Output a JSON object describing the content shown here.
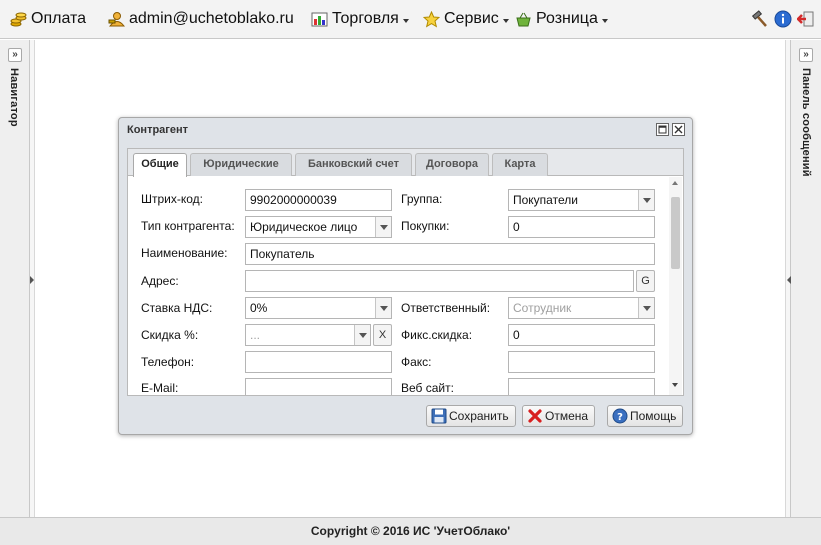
{
  "topbar": {
    "items": [
      {
        "label": "Оплата"
      },
      {
        "label": "admin@uchetoblako.ru"
      },
      {
        "label": "Торговля"
      },
      {
        "label": "Сервис"
      },
      {
        "label": "Розница"
      }
    ]
  },
  "left_panel": {
    "label": "Навигатор",
    "collapse_glyph": "»"
  },
  "right_panel": {
    "label": "Панель сообщений",
    "collapse_glyph": "»"
  },
  "footer": {
    "copyright": "Copyright © 2016 ИС 'УчетОблако'"
  },
  "dialog": {
    "title": "Контрагент",
    "tabs": [
      {
        "label": "Общие"
      },
      {
        "label": "Юридические"
      },
      {
        "label": "Банковский счет"
      },
      {
        "label": "Договора"
      },
      {
        "label": "Карта"
      }
    ],
    "active_tab": "Общие",
    "fields": {
      "barcode": {
        "label": "Штрих-код:",
        "value": "9902000000039"
      },
      "group": {
        "label": "Группа:",
        "value": "Покупатели"
      },
      "contractor_type": {
        "label": "Тип контрагента:",
        "value": "Юридическое лицо"
      },
      "purchases": {
        "label": "Покупки:",
        "value": "0"
      },
      "name": {
        "label": "Наименование:",
        "value": "Покупатель"
      },
      "address": {
        "label": "Адрес:",
        "value": "",
        "button": "G"
      },
      "vat_rate": {
        "label": "Ставка НДС:",
        "value": "0%"
      },
      "responsible": {
        "label": "Ответственный:",
        "value": "Сотрудник"
      },
      "discount": {
        "label": "Скидка %:",
        "value": "...",
        "clear_button": "X"
      },
      "fixed_discount": {
        "label": "Фикс.скидка:",
        "value": "0"
      },
      "phone": {
        "label": "Телефон:",
        "value": ""
      },
      "fax": {
        "label": "Факс:",
        "value": ""
      },
      "email": {
        "label": "E-Mail:",
        "value": ""
      },
      "website": {
        "label": "Веб сайт:",
        "value": ""
      }
    },
    "buttons": {
      "save": "Сохранить",
      "cancel": "Отмена",
      "help": "Помощь"
    }
  }
}
